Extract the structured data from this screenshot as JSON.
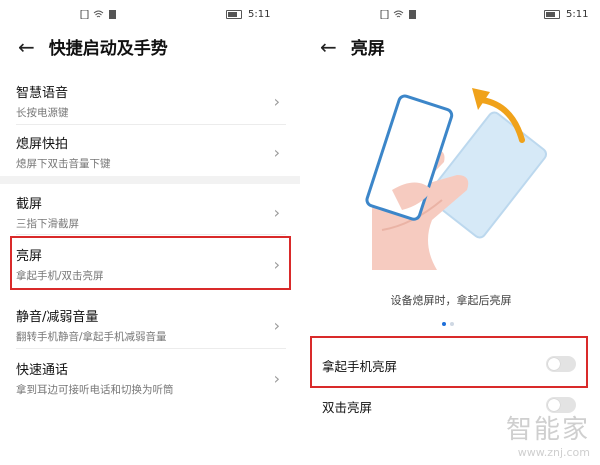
{
  "left": {
    "status": {
      "time": "5:11"
    },
    "header": {
      "title": "快捷启动及手势"
    },
    "items": [
      {
        "title": "智慧语音",
        "subtitle": "长按电源键"
      },
      {
        "title": "熄屏快拍",
        "subtitle": "熄屏下双击音量下键"
      },
      {
        "title": "截屏",
        "subtitle": "三指下滑截屏"
      },
      {
        "title": "亮屏",
        "subtitle": "拿起手机/双击亮屏"
      },
      {
        "title": "静音/减弱音量",
        "subtitle": "翻转手机静音/拿起手机减弱音量"
      },
      {
        "title": "快速通话",
        "subtitle": "拿到耳边可接听电话和切换为听筒"
      }
    ]
  },
  "right": {
    "status": {
      "time": "5:11"
    },
    "header": {
      "title": "亮屏"
    },
    "description": "设备熄屏时，拿起后亮屏",
    "pager": {
      "count": 2,
      "active": 0
    },
    "settings": [
      {
        "label": "拿起手机亮屏",
        "enabled": false
      },
      {
        "label": "双击亮屏",
        "enabled": false
      }
    ]
  },
  "colors": {
    "highlight": "#d92a2a",
    "accent": "#1e6fd9",
    "arrow": "#f0a21a"
  },
  "watermark": {
    "big": "智能家",
    "small": "www.znj.com"
  }
}
